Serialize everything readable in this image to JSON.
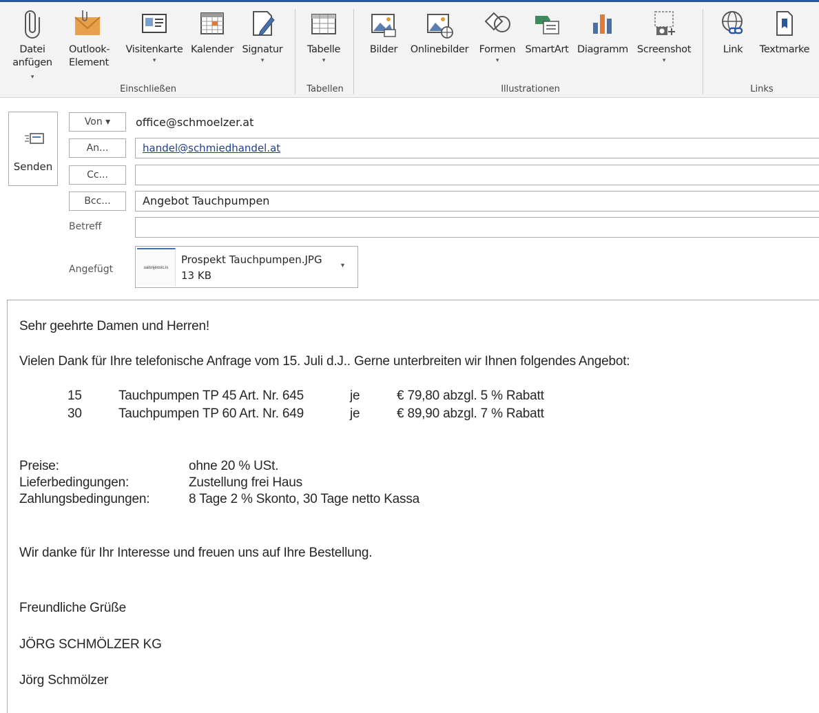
{
  "ribbon": {
    "buttons": [
      {
        "line1": "Datei",
        "line2": "anfügen",
        "caret": "▾"
      },
      {
        "line1": "Outlook-",
        "line2": "Element"
      },
      {
        "line1": "Visitenkarte",
        "caret": "▾"
      },
      {
        "line1": "Kalender"
      },
      {
        "line1": "Signatur",
        "caret": "▾"
      },
      {
        "line1": "Tabelle",
        "caret": "▾"
      },
      {
        "line1": "Bilder"
      },
      {
        "line1": "Onlinebilder"
      },
      {
        "line1": "Formen",
        "caret": "▾"
      },
      {
        "line1": "SmartArt"
      },
      {
        "line1": "Diagramm"
      },
      {
        "line1": "Screenshot",
        "caret": "▾"
      },
      {
        "line1": "Link"
      },
      {
        "line1": "Textmarke"
      }
    ],
    "groups": {
      "einschliessen": "Einschließen",
      "tabellen": "Tabellen",
      "illustrationen": "Illustrationen",
      "links": "Links"
    }
  },
  "header": {
    "send_label": "Senden",
    "from_button": "Von ▾",
    "from_value": "office@schmoelzer.at",
    "to_button": "An...",
    "to_value": "handel@schmiedhandel.at",
    "cc_button": "Cc...",
    "cc_value": "",
    "bcc_button": "Bcc...",
    "bcc_value": "Angebot Tauchpumpen",
    "subject_label": "Betreff",
    "subject_value": "",
    "attached_label": "Angefügt",
    "attachment": {
      "name": "Prospekt Tauchpumpen.JPG",
      "size": "13 KB",
      "thumb_text": "ualsnjeosic.is"
    }
  },
  "body": {
    "greeting": "Sehr geehrte Damen und Herren!",
    "intro": "Vielen Dank für Ihre telefonische Anfrage vom 15. Juli d.J.. Gerne unterbreiten wir Ihnen folgendes Angebot:",
    "items": [
      {
        "qty": "15",
        "desc": "Tauchpumpen TP 45 Art. Nr. 645",
        "unit": "je",
        "price": "€ 79,80 abzgl. 5 % Rabatt"
      },
      {
        "qty": "30",
        "desc": "Tauchpumpen TP 60 Art. Nr. 649",
        "unit": "je",
        "price": "€ 89,90 abzgl. 7 % Rabatt"
      }
    ],
    "terms": [
      {
        "label": "Preise:",
        "value": "ohne 20 % USt."
      },
      {
        "label": "Lieferbedingungen:",
        "value": "Zustellung frei Haus"
      },
      {
        "label": "Zahlungsbedingungen:",
        "value": "8 Tage 2 % Skonto, 30 Tage netto Kassa"
      }
    ],
    "thanks": "Wir danke für Ihr Interesse und freuen uns auf Ihre Bestellung.",
    "closing": "Freundliche Grüße",
    "company": "JÖRG SCHMÖLZER KG",
    "signature": "Jörg Schmölzer"
  },
  "colors": {
    "accent": "#2b579a",
    "link": "#1f3f8c",
    "ribbon_bg": "#f3f3f3"
  }
}
